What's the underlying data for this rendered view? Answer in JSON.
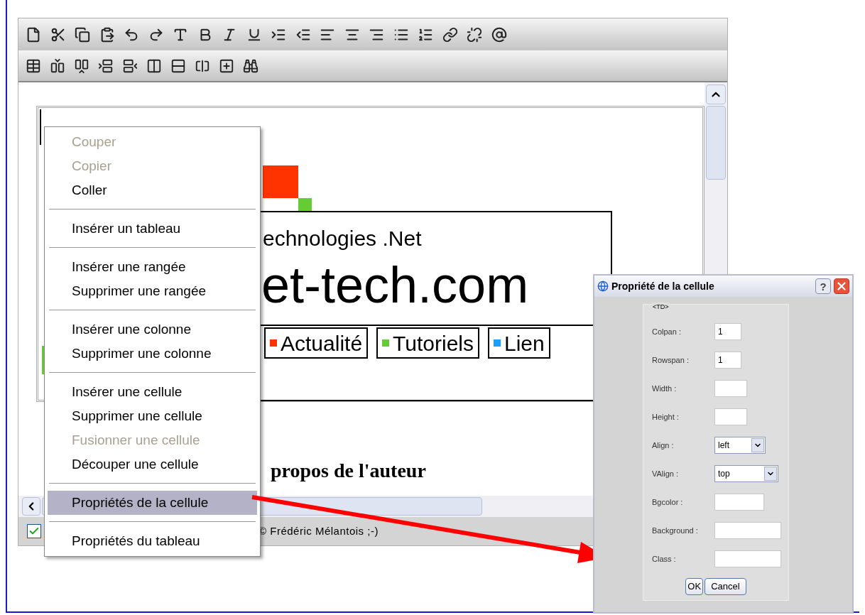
{
  "content": {
    "subtitle": "echnologies .Net",
    "logo_text": "et-tech.com",
    "nav": [
      {
        "label": "Actualité",
        "color": "#ff3300"
      },
      {
        "label": "Tutoriels",
        "color": "#66cc33"
      },
      {
        "label": "Lien",
        "color": "#1a9eff"
      }
    ],
    "heading": "propos de l'auteur"
  },
  "status_bar": {
    "checked": true,
    "text": "© Frédéric Mélantois ;-)"
  },
  "context_menu": {
    "groups": [
      {
        "items": [
          {
            "label": "Couper",
            "disabled": true,
            "selected": false
          },
          {
            "label": "Copier",
            "disabled": true,
            "selected": false
          },
          {
            "label": "Coller",
            "disabled": false,
            "selected": false
          }
        ]
      },
      {
        "items": [
          {
            "label": "Insérer un tableau",
            "disabled": false,
            "selected": false
          }
        ]
      },
      {
        "items": [
          {
            "label": "Insérer une rangée",
            "disabled": false,
            "selected": false
          },
          {
            "label": "Supprimer une rangée",
            "disabled": false,
            "selected": false
          }
        ]
      },
      {
        "items": [
          {
            "label": "Insérer une colonne",
            "disabled": false,
            "selected": false
          },
          {
            "label": "Supprimer une colonne",
            "disabled": false,
            "selected": false
          }
        ]
      },
      {
        "items": [
          {
            "label": "Insérer une cellule",
            "disabled": false,
            "selected": false
          },
          {
            "label": "Supprimer une cellule",
            "disabled": false,
            "selected": false
          },
          {
            "label": "Fusionner une cellule",
            "disabled": true,
            "selected": false
          },
          {
            "label": "Découper une cellule",
            "disabled": false,
            "selected": false
          }
        ]
      },
      {
        "items": [
          {
            "label": "Propriétés de la cellule",
            "disabled": false,
            "selected": true
          }
        ]
      },
      {
        "items": [
          {
            "label": "Propriétés du tableau",
            "disabled": false,
            "selected": false
          }
        ]
      }
    ]
  },
  "dialog": {
    "title": "Propriété de la cellule",
    "help": "?",
    "group_label": "<TD>",
    "fields": [
      {
        "label": "Colpan :",
        "value": "1",
        "kind": "text"
      },
      {
        "label": "Rowspan :",
        "value": "1",
        "kind": "text"
      },
      {
        "label": "Width :",
        "kind": "text"
      },
      {
        "label": "Height :",
        "kind": "text"
      },
      {
        "label": "Align :",
        "value": "left",
        "kind": "select"
      },
      {
        "label": "VAlign :",
        "value": "top",
        "kind": "select"
      },
      {
        "label": "Bgcolor :",
        "kind": "text"
      },
      {
        "label": "Background :",
        "kind": "text"
      },
      {
        "label": "Class :",
        "kind": "text"
      }
    ],
    "buttons": [
      "OK",
      "Cancel"
    ]
  }
}
